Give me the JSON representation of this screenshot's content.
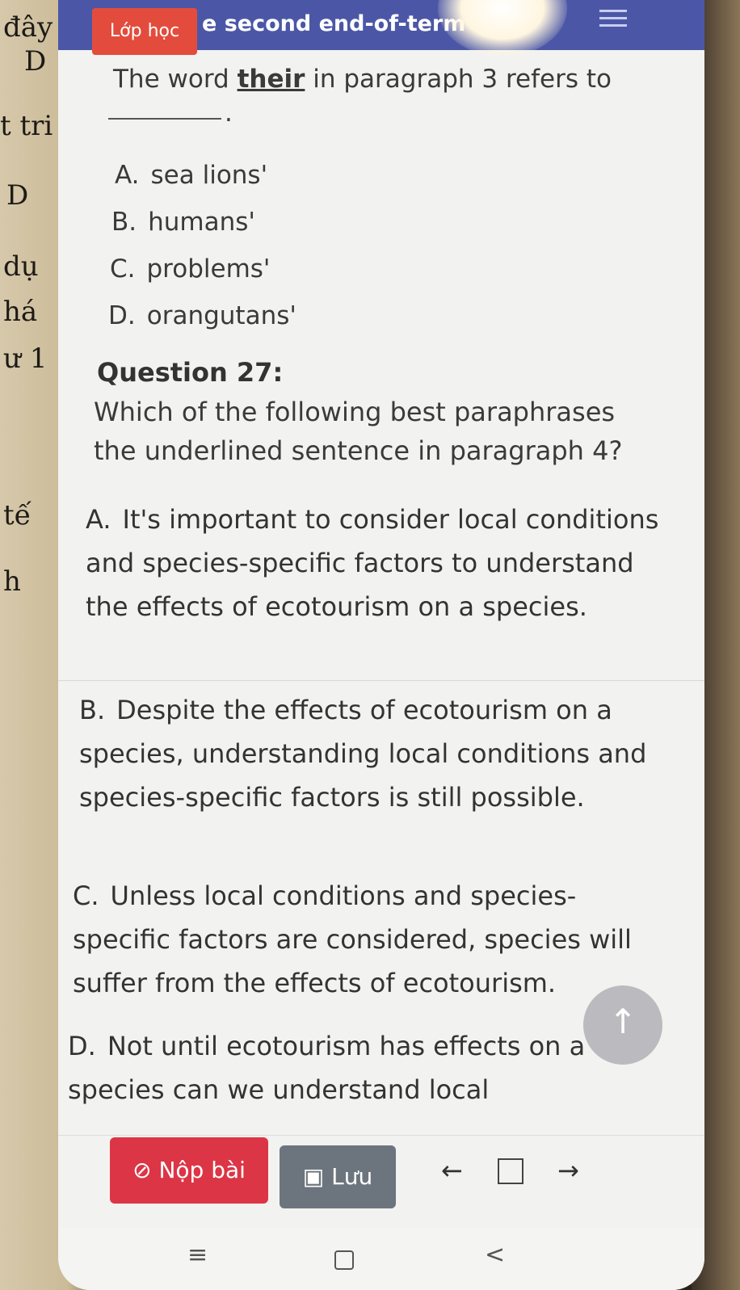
{
  "topbar": {
    "tab_label": "Lớp học",
    "title": "e second end-of-term"
  },
  "paper_fragments": [
    "đây",
    "D",
    "t tri",
    "D",
    "dụ",
    "há",
    "ư 1",
    "tế",
    "h"
  ],
  "previous_question": {
    "intro_before": "The word ",
    "intro_highlight": "their",
    "intro_after": " in paragraph 3 refers to",
    "blank_suffix": ".",
    "options": [
      {
        "letter": "A.",
        "text": "sea lions'"
      },
      {
        "letter": "B.",
        "text": "humans'"
      },
      {
        "letter": "C.",
        "text": "problems'"
      },
      {
        "letter": "D.",
        "text": "orangutans'"
      }
    ]
  },
  "question": {
    "heading": "Question 27:",
    "body": "Which of the following best paraphrases the underlined sentence in paragraph 4?",
    "answers": [
      {
        "letter": "A.",
        "text": "It's important to consider local conditions and species-specific factors to understand the effects of ecotourism on a species."
      },
      {
        "letter": "B.",
        "text": "Despite the effects of ecotourism on a species, understanding local conditions and species-specific factors is still possible."
      },
      {
        "letter": "C.",
        "text": "Unless local conditions and species-specific factors are considered, species will suffer from the effects of ecotourism."
      },
      {
        "letter": "D.",
        "text": "Not until ecotourism has effects on a species can we understand local"
      }
    ]
  },
  "actions": {
    "submit_label": "Nộp bài",
    "save_label": "Lưu",
    "prev_symbol": "←",
    "next_symbol": "→"
  },
  "system_nav": {
    "recent": "≡",
    "back": "<"
  },
  "colors": {
    "topbar": "#4b57a6",
    "tab": "#e34c3c",
    "submit": "#dc3545",
    "save": "#6c757d"
  }
}
